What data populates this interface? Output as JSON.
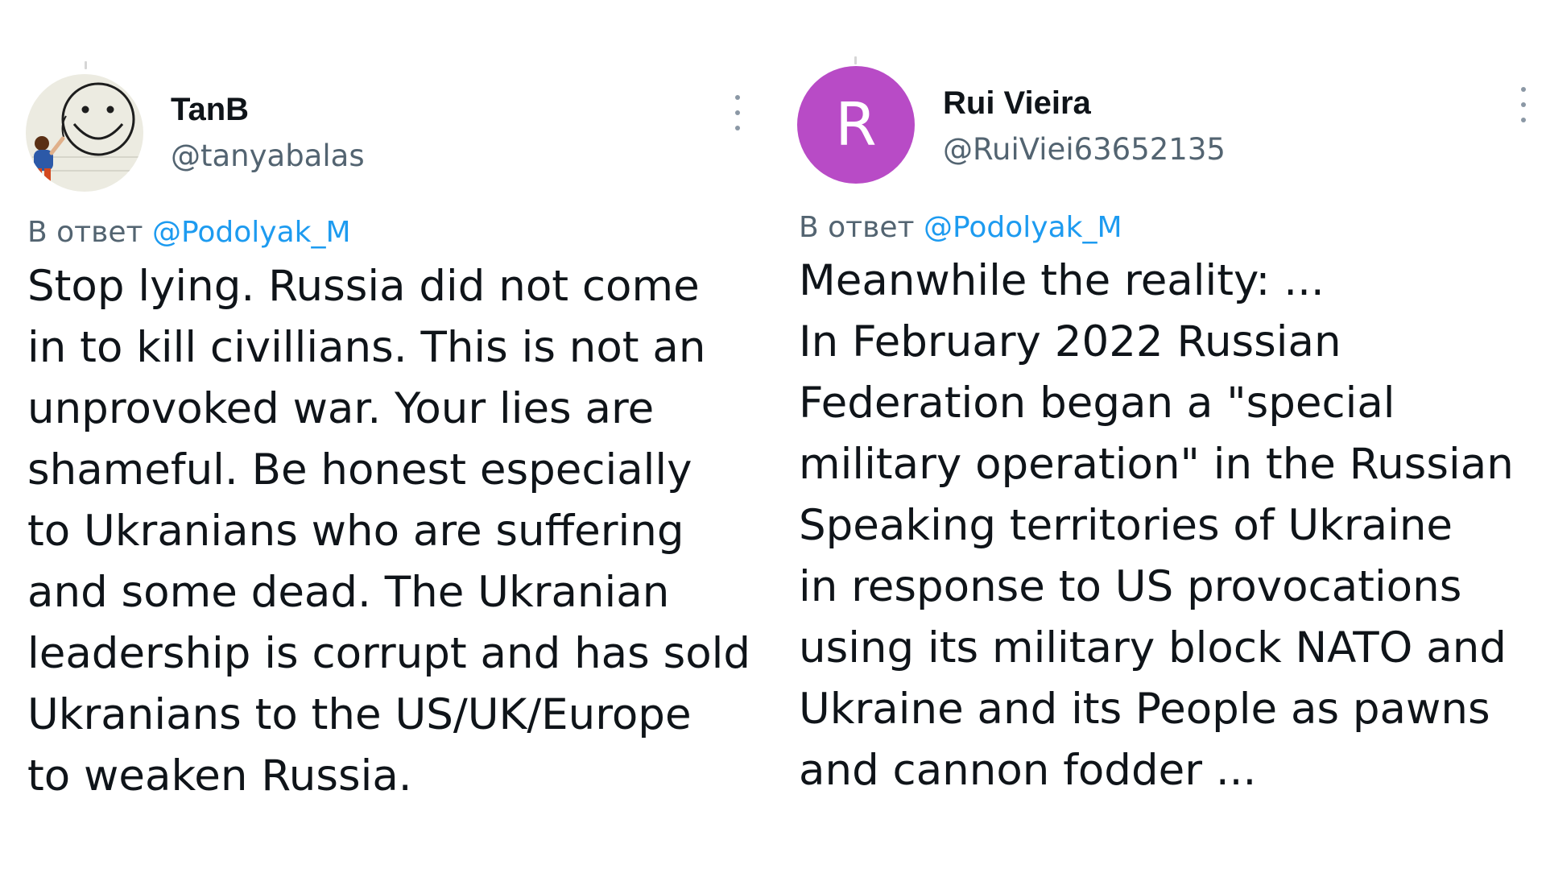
{
  "tweets": [
    {
      "display_name": "TanB",
      "handle": "@tanyabalas",
      "avatar_icon": "smiley-drawing-avatar",
      "reply_prefix": "В ответ",
      "reply_to": "@Podolyak_M",
      "text_lines": [
        "Stop lying. Russia did not come",
        "in to kill civillians. This is not an",
        "unprovoked war. Your lies are",
        "shameful. Be honest especially",
        "to Ukranians who are suffering",
        "and some dead. The Ukranian",
        "leadership is corrupt and has sold",
        "Ukranians to the US/UK/Europe",
        "to weaken Russia."
      ]
    },
    {
      "display_name": "Rui Vieira",
      "handle": "@RuiViei63652135",
      "avatar_letter": "R",
      "avatar_color": "#b84bc6",
      "reply_prefix": "В ответ",
      "reply_to": "@Podolyak_M",
      "text_lines": [
        "Meanwhile the reality: ...",
        "In February 2022 Russian",
        "Federation began a \"special",
        "military operation\" in the Russian",
        "Speaking territories of Ukraine",
        "in response to US provocations",
        "using its military block NATO and",
        "Ukraine and its People as pawns",
        "and cannon fodder ..."
      ]
    }
  ],
  "colors": {
    "text": "#0f1419",
    "secondary": "#536471",
    "link": "#1d9bf0",
    "more_dots": "#8b98a5"
  }
}
